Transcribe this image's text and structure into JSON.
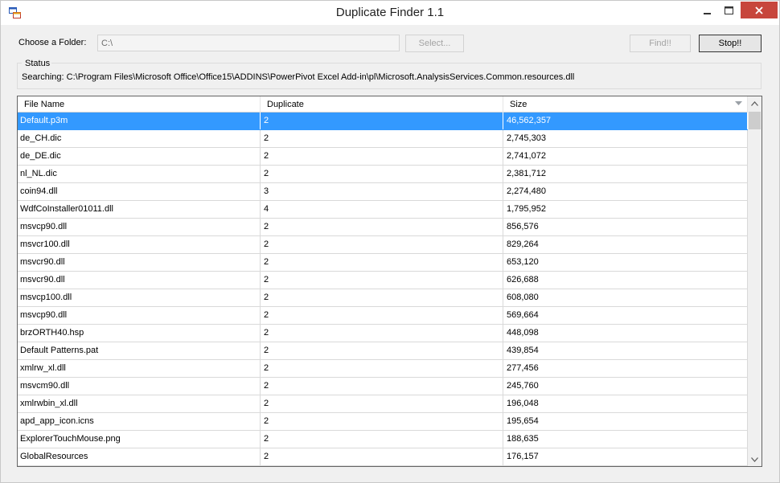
{
  "window": {
    "title": "Duplicate Finder 1.1"
  },
  "folder": {
    "label": "Choose a Folder:",
    "value": "C:\\",
    "select_label": "Select..."
  },
  "actions": {
    "find_label": "Find!!",
    "stop_label": "Stop!!"
  },
  "status": {
    "legend": "Status",
    "text": "Searching: C:\\Program Files\\Microsoft Office\\Office15\\ADDINS\\PowerPivot Excel Add-in\\pl\\Microsoft.AnalysisServices.Common.resources.dll"
  },
  "grid": {
    "columns": [
      "File Name",
      "Duplicate",
      "Size"
    ],
    "rows": [
      [
        "Default.p3m",
        "2",
        "46,562,357"
      ],
      [
        "de_CH.dic",
        "2",
        "2,745,303"
      ],
      [
        "de_DE.dic",
        "2",
        "2,741,072"
      ],
      [
        "nl_NL.dic",
        "2",
        "2,381,712"
      ],
      [
        "coin94.dll",
        "3",
        "2,274,480"
      ],
      [
        "WdfCoInstaller01011.dll",
        "4",
        "1,795,952"
      ],
      [
        "msvcp90.dll",
        "2",
        "856,576"
      ],
      [
        "msvcr100.dll",
        "2",
        "829,264"
      ],
      [
        "msvcr90.dll",
        "2",
        "653,120"
      ],
      [
        "msvcr90.dll",
        "2",
        "626,688"
      ],
      [
        "msvcp100.dll",
        "2",
        "608,080"
      ],
      [
        "msvcp90.dll",
        "2",
        "569,664"
      ],
      [
        "brzORTH40.hsp",
        "2",
        "448,098"
      ],
      [
        "Default Patterns.pat",
        "2",
        "439,854"
      ],
      [
        "xmlrw_xl.dll",
        "2",
        "277,456"
      ],
      [
        "msvcm90.dll",
        "2",
        "245,760"
      ],
      [
        "xmlrwbin_xl.dll",
        "2",
        "196,048"
      ],
      [
        "apd_app_icon.icns",
        "2",
        "195,654"
      ],
      [
        "ExplorerTouchMouse.png",
        "2",
        "188,635"
      ],
      [
        "GlobalResources",
        "2",
        "176,157"
      ],
      [
        "",
        "",
        ""
      ]
    ]
  },
  "colors": {
    "selection": "#3399ff",
    "close_button": "#c7463c",
    "window_bg": "#f0f0f0"
  },
  "icons": {
    "app": "app-window-icon",
    "minimize": "minimize-icon",
    "maximize": "maximize-icon",
    "close": "close-icon",
    "sort": "sort-descending-icon",
    "scroll_up": "chevron-up-icon",
    "scroll_down": "chevron-down-icon"
  }
}
